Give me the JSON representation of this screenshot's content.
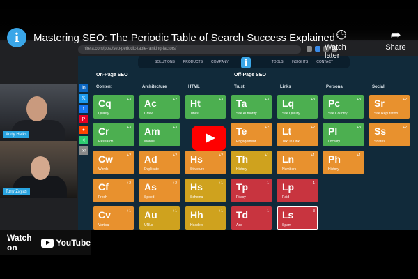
{
  "video": {
    "title": "Mastering SEO: The Periodic Table of Search Success Explained",
    "channel_icon": "i",
    "watch_later": "Watch later",
    "share": "Share",
    "watch_on": "Watch on",
    "youtube": "YouTube"
  },
  "browser": {
    "url": "hireia.com/post/seo-periodic-table-ranking-factors/"
  },
  "site": {
    "logo": "i",
    "nav_left": [
      "SOLUTIONS",
      "PRODUCTS",
      "COMPANY"
    ],
    "nav_right": [
      "TOOLS",
      "INSIGHTS",
      "CONTACT"
    ],
    "on_page_title": "On-Page SEO",
    "off_page_title": "Off-Page SEO",
    "categories": [
      "Content",
      "Architecture",
      "HTML",
      "Trust",
      "Links",
      "Personal",
      "Social"
    ]
  },
  "tiles": [
    {
      "sym": "Cq",
      "name": "Quality",
      "w": "+3",
      "color": "green",
      "col": 0,
      "row": 0
    },
    {
      "sym": "Ac",
      "name": "Crawl",
      "w": "+2",
      "color": "green",
      "col": 1,
      "row": 0
    },
    {
      "sym": "Ht",
      "name": "Titles",
      "w": "+3",
      "color": "green",
      "col": 2,
      "row": 0
    },
    {
      "sym": "Ta",
      "name": "Site Authority",
      "w": "+3",
      "color": "green",
      "col": 3,
      "row": 0
    },
    {
      "sym": "Lq",
      "name": "Site Quality",
      "w": "+3",
      "color": "green",
      "col": 4,
      "row": 0
    },
    {
      "sym": "Pc",
      "name": "Site Country",
      "w": "+3",
      "color": "green",
      "col": 5,
      "row": 0
    },
    {
      "sym": "Sr",
      "name": "Site Reputation",
      "w": "+2",
      "color": "orange",
      "col": 6,
      "row": 0
    },
    {
      "sym": "Cr",
      "name": "Research",
      "w": "+3",
      "color": "green",
      "col": 0,
      "row": 1
    },
    {
      "sym": "Am",
      "name": "Mobile",
      "w": "+3",
      "color": "green",
      "col": 1,
      "row": 1
    },
    {
      "sym": "Te",
      "name": "Engagement",
      "w": "+2",
      "color": "orange",
      "col": 3,
      "row": 1
    },
    {
      "sym": "Lt",
      "name": "Text in Link",
      "w": "+2",
      "color": "orange",
      "col": 4,
      "row": 1
    },
    {
      "sym": "Pl",
      "name": "Locality",
      "w": "+3",
      "color": "green",
      "col": 5,
      "row": 1
    },
    {
      "sym": "Ss",
      "name": "Shares",
      "w": "+2",
      "color": "orange",
      "col": 6,
      "row": 1
    },
    {
      "sym": "Cw",
      "name": "Words",
      "w": "+2",
      "color": "orange",
      "col": 0,
      "row": 2
    },
    {
      "sym": "Ad",
      "name": "Duplicate",
      "w": "+2",
      "color": "orange",
      "col": 1,
      "row": 2
    },
    {
      "sym": "Hs",
      "name": "Structure",
      "w": "+2",
      "color": "orange",
      "col": 2,
      "row": 2
    },
    {
      "sym": "Th",
      "name": "History",
      "w": "+1",
      "color": "yellow",
      "col": 3,
      "row": 2
    },
    {
      "sym": "Ln",
      "name": "Numbers",
      "w": "+1",
      "color": "orange",
      "col": 4,
      "row": 2
    },
    {
      "sym": "Ph",
      "name": "History",
      "w": "+1",
      "color": "orange",
      "col": 5,
      "row": 2
    },
    {
      "sym": "Cf",
      "name": "Fresh",
      "w": "+2",
      "color": "orange",
      "col": 0,
      "row": 3
    },
    {
      "sym": "As",
      "name": "Speed",
      "w": "+2",
      "color": "orange",
      "col": 1,
      "row": 3
    },
    {
      "sym": "Hs",
      "name": "Schema",
      "w": "+1",
      "color": "yellow",
      "col": 2,
      "row": 3
    },
    {
      "sym": "Tp",
      "name": "Piracy",
      "w": "-1",
      "color": "red",
      "col": 3,
      "row": 3
    },
    {
      "sym": "Lp",
      "name": "Paid",
      "w": "-1",
      "color": "red",
      "col": 4,
      "row": 3
    },
    {
      "sym": "Cv",
      "name": "Vertical",
      "w": "+1",
      "color": "orange",
      "col": 0,
      "row": 4
    },
    {
      "sym": "Au",
      "name": "URLs",
      "w": "+1",
      "color": "yellow",
      "col": 1,
      "row": 4
    },
    {
      "sym": "Hh",
      "name": "Headers",
      "w": "+1",
      "color": "yellow",
      "col": 2,
      "row": 4
    },
    {
      "sym": "Td",
      "name": "Ads",
      "w": "-1",
      "color": "red",
      "col": 3,
      "row": 4
    },
    {
      "sym": "Ls",
      "name": "Spam",
      "w": "-3",
      "color": "red",
      "col": 4,
      "row": 4,
      "outlined": true
    }
  ],
  "partial_row_colors": [
    "orange",
    "yellow",
    "red"
  ],
  "share_rail": [
    {
      "icon": "linkedin-icon",
      "glyph": "in",
      "color": "#0a66c2"
    },
    {
      "icon": "x-icon",
      "glyph": "𝕏",
      "color": "#1d9bf0"
    },
    {
      "icon": "facebook-icon",
      "glyph": "f",
      "color": "#1877f2"
    },
    {
      "icon": "pinterest-icon",
      "glyph": "P",
      "color": "#e60023"
    },
    {
      "icon": "reddit-icon",
      "glyph": "●",
      "color": "#ff4500"
    },
    {
      "icon": "share-icon",
      "glyph": "<",
      "color": "#2ecc71"
    },
    {
      "icon": "email-icon",
      "glyph": "✉",
      "color": "#888888"
    }
  ],
  "participants": [
    {
      "name": "Andy Halks"
    },
    {
      "name": "Tony Zayas"
    }
  ]
}
